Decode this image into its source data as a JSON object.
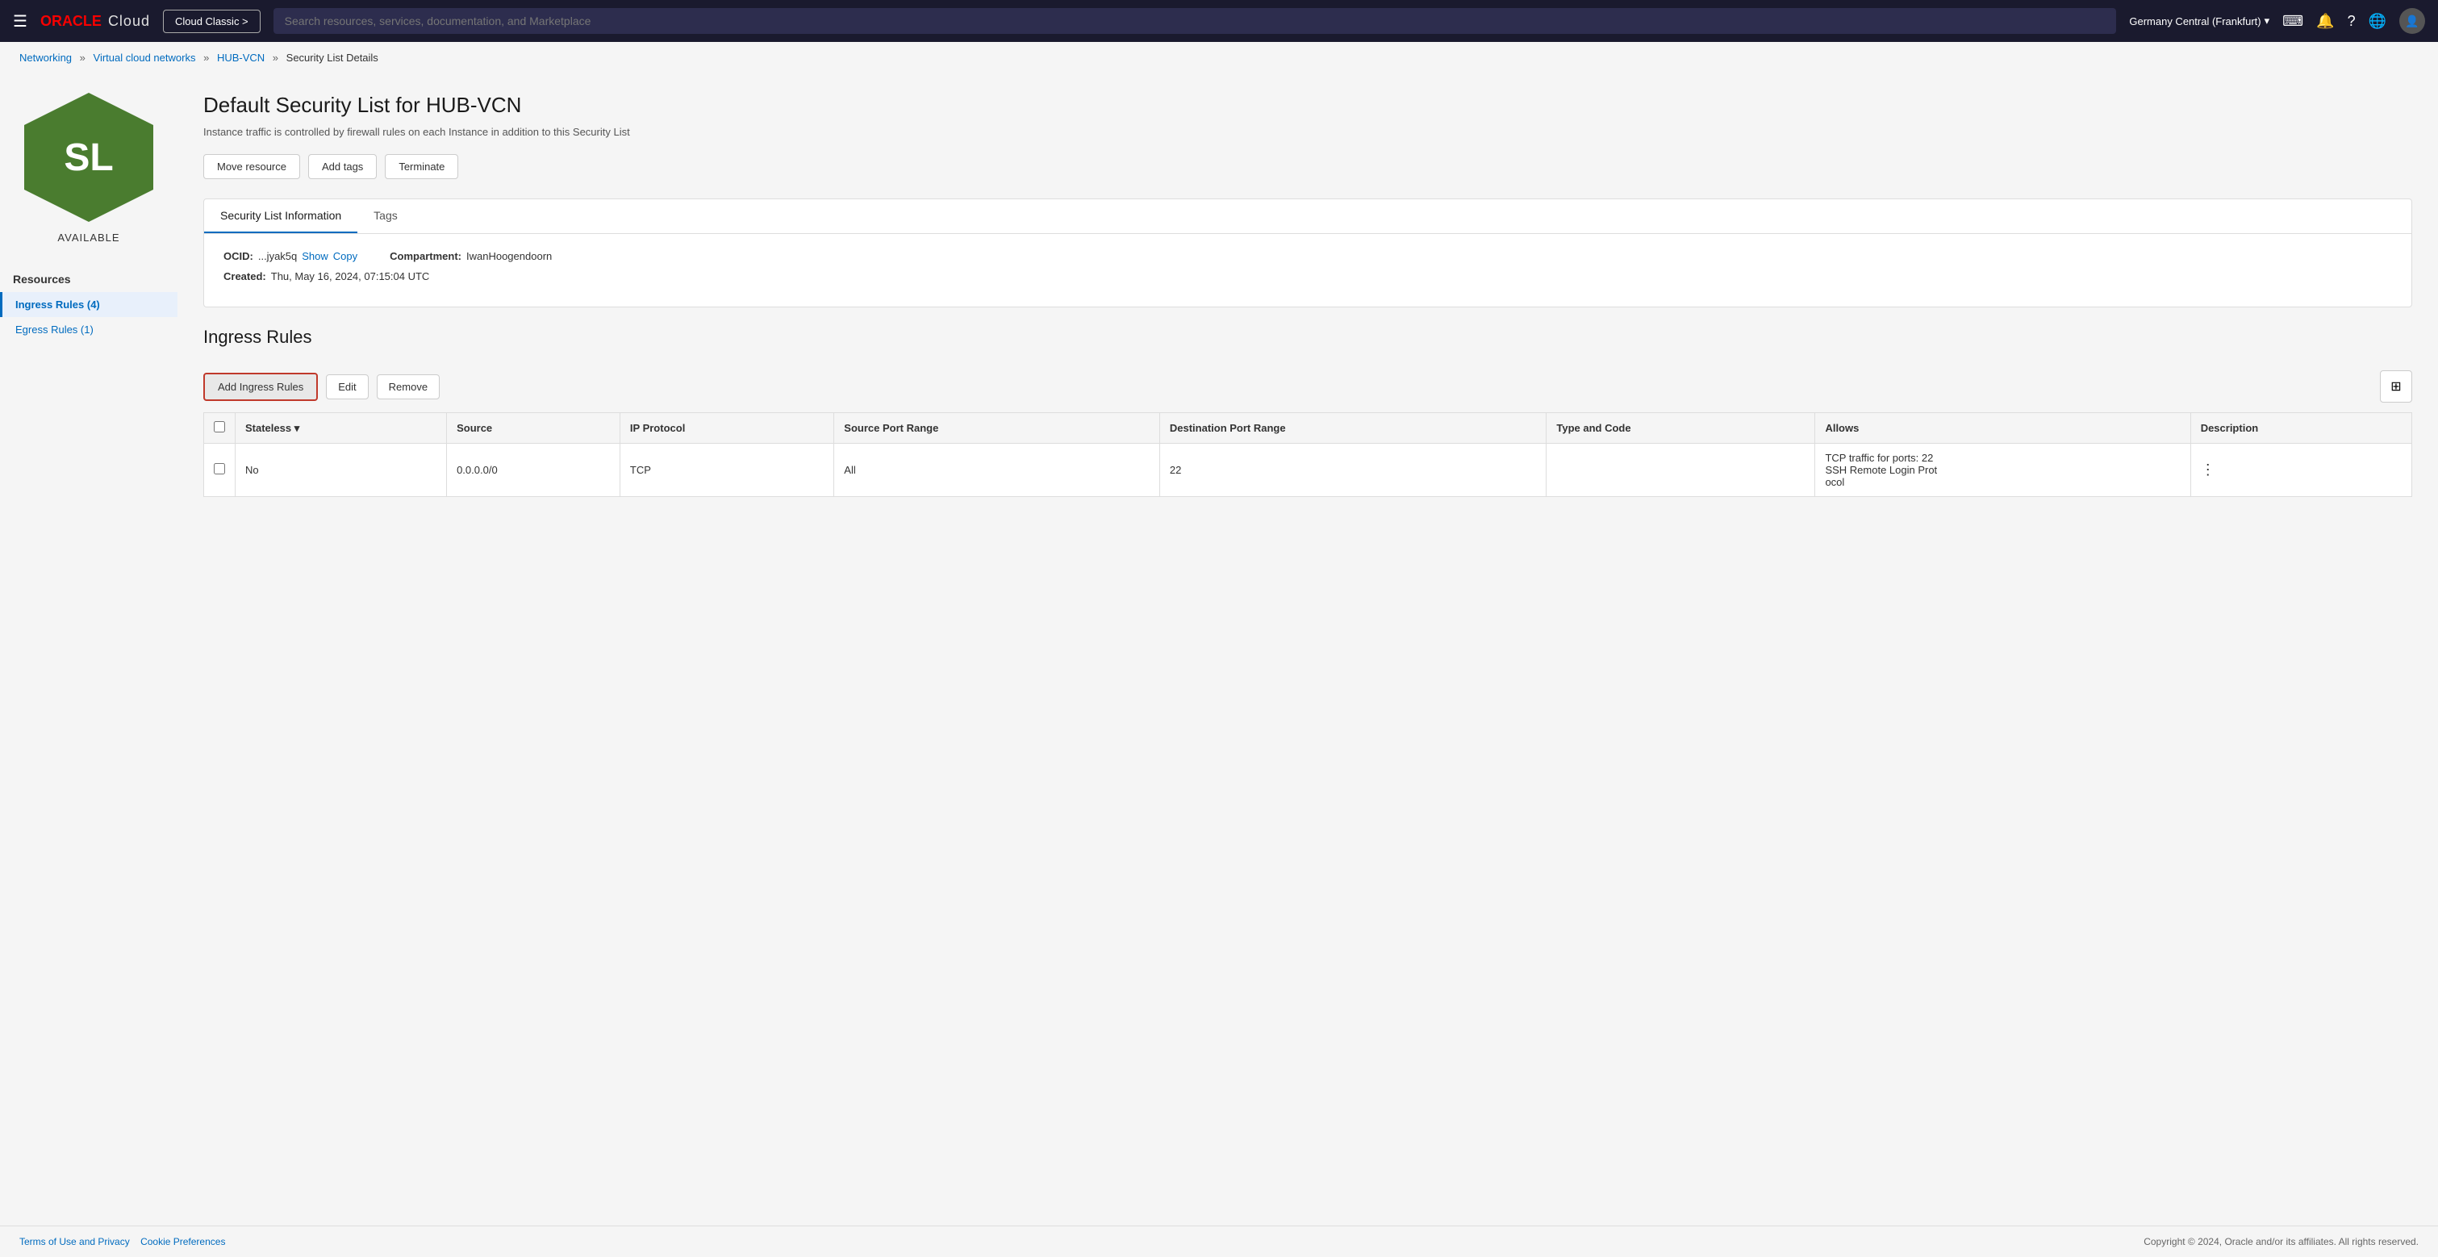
{
  "nav": {
    "hamburger_label": "☰",
    "oracle_label": "ORACLE",
    "cloud_label": "Cloud",
    "cloud_classic_label": "Cloud Classic >",
    "search_placeholder": "Search resources, services, documentation, and Marketplace",
    "region_label": "Germany Central (Frankfurt)",
    "region_chevron": "▾",
    "icons": {
      "terminal": "⌨",
      "bell": "🔔",
      "help": "?",
      "globe": "🌐",
      "user": "👤"
    }
  },
  "breadcrumb": {
    "items": [
      {
        "label": "Networking",
        "href": "#"
      },
      {
        "label": "Virtual cloud networks",
        "href": "#"
      },
      {
        "label": "HUB-VCN",
        "href": "#"
      },
      {
        "label": "Security List Details",
        "current": true
      }
    ]
  },
  "resource": {
    "icon_text": "SL",
    "status": "AVAILABLE"
  },
  "sidebar": {
    "resources_label": "Resources",
    "items": [
      {
        "label": "Ingress Rules (4)",
        "active": true,
        "href": "#"
      },
      {
        "label": "Egress Rules (1)",
        "active": false,
        "href": "#"
      }
    ]
  },
  "page": {
    "title": "Default Security List for HUB-VCN",
    "subtitle": "Instance traffic is controlled by firewall rules on each Instance in addition to this Security List"
  },
  "action_buttons": [
    {
      "label": "Move resource"
    },
    {
      "label": "Add tags"
    },
    {
      "label": "Terminate"
    }
  ],
  "tabs": [
    {
      "label": "Security List Information",
      "active": true
    },
    {
      "label": "Tags",
      "active": false
    }
  ],
  "info": {
    "ocid_label": "OCID:",
    "ocid_value": "...jyak5q",
    "show_label": "Show",
    "copy_label": "Copy",
    "created_label": "Created:",
    "created_value": "Thu, May 16, 2024, 07:15:04 UTC",
    "compartment_label": "Compartment:",
    "compartment_value": "IwanHoogendoorn"
  },
  "ingress": {
    "section_title": "Ingress Rules",
    "add_button": "Add Ingress Rules",
    "edit_button": "Edit",
    "remove_button": "Remove",
    "table": {
      "columns": [
        {
          "label": "Stateless ▾",
          "sortable": true
        },
        {
          "label": "Source"
        },
        {
          "label": "IP Protocol"
        },
        {
          "label": "Source Port Range"
        },
        {
          "label": "Destination Port Range"
        },
        {
          "label": "Type and Code"
        },
        {
          "label": "Allows"
        },
        {
          "label": "Description"
        }
      ],
      "rows": [
        {
          "stateless": "No",
          "source": "0.0.0.0/0",
          "ip_protocol": "TCP",
          "source_port_range": "All",
          "destination_port_range": "22",
          "type_and_code": "",
          "allows": "TCP traffic for ports: 22\nSSH Remote Login Prot\nocol",
          "description": ""
        }
      ]
    }
  },
  "footer": {
    "terms_label": "Terms of Use and Privacy",
    "cookie_label": "Cookie Preferences",
    "copyright": "Copyright © 2024, Oracle and/or its affiliates. All rights reserved."
  }
}
